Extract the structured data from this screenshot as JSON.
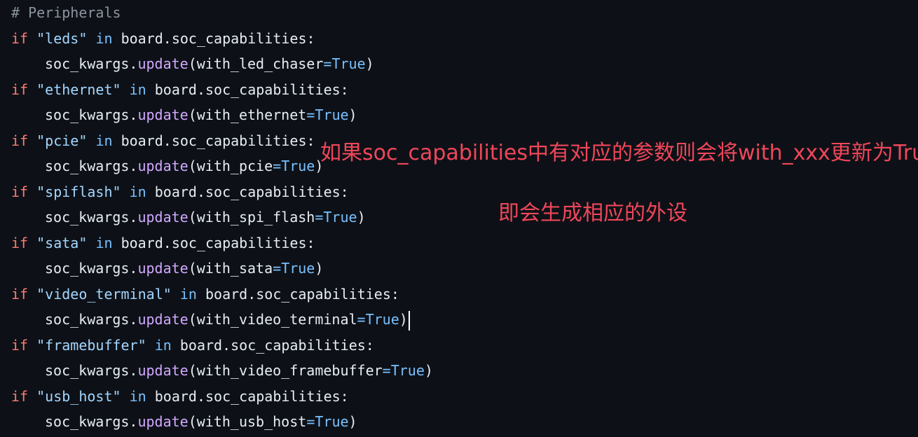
{
  "comment": "# Peripherals",
  "keywords": {
    "if": "if",
    "in": "in"
  },
  "colors": {
    "background": "#0d1117",
    "keyword": "#ff7b72",
    "string": "#a5d6ff",
    "builtin": "#79c0ff",
    "function": "#d2a8ff",
    "comment": "#8b949e",
    "annotation": "#f0465a"
  },
  "blocks": [
    {
      "cap": "\"leds\"",
      "obj": "board.soc_capabilities:",
      "var": "soc_kwargs",
      "method": "update",
      "arg": "with_led_chaser",
      "value": "True"
    },
    {
      "cap": "\"ethernet\"",
      "obj": "board.soc_capabilities:",
      "var": "soc_kwargs",
      "method": "update",
      "arg": "with_ethernet",
      "value": "True"
    },
    {
      "cap": "\"pcie\"",
      "obj": "board.soc_capabilities:",
      "var": "soc_kwargs",
      "method": "update",
      "arg": "with_pcie",
      "value": "True"
    },
    {
      "cap": "\"spiflash\"",
      "obj": "board.soc_capabilities:",
      "var": "soc_kwargs",
      "method": "update",
      "arg": "with_spi_flash",
      "value": "True"
    },
    {
      "cap": "\"sata\"",
      "obj": "board.soc_capabilities:",
      "var": "soc_kwargs",
      "method": "update",
      "arg": "with_sata",
      "value": "True"
    },
    {
      "cap": "\"video_terminal\"",
      "obj": "board.soc_capabilities:",
      "var": "soc_kwargs",
      "method": "update",
      "arg": "with_video_terminal",
      "value": "True"
    },
    {
      "cap": "\"framebuffer\"",
      "obj": "board.soc_capabilities:",
      "var": "soc_kwargs",
      "method": "update",
      "arg": "with_video_framebuffer",
      "value": "True"
    },
    {
      "cap": "\"usb_host\"",
      "obj": "board.soc_capabilities:",
      "var": "soc_kwargs",
      "method": "update",
      "arg": "with_usb_host",
      "value": "True"
    }
  ],
  "annotations": {
    "line1": "如果soc_capabilities中有对应的参数则会将with_xxx更新为True",
    "line2": "即会生成相应的外设"
  }
}
